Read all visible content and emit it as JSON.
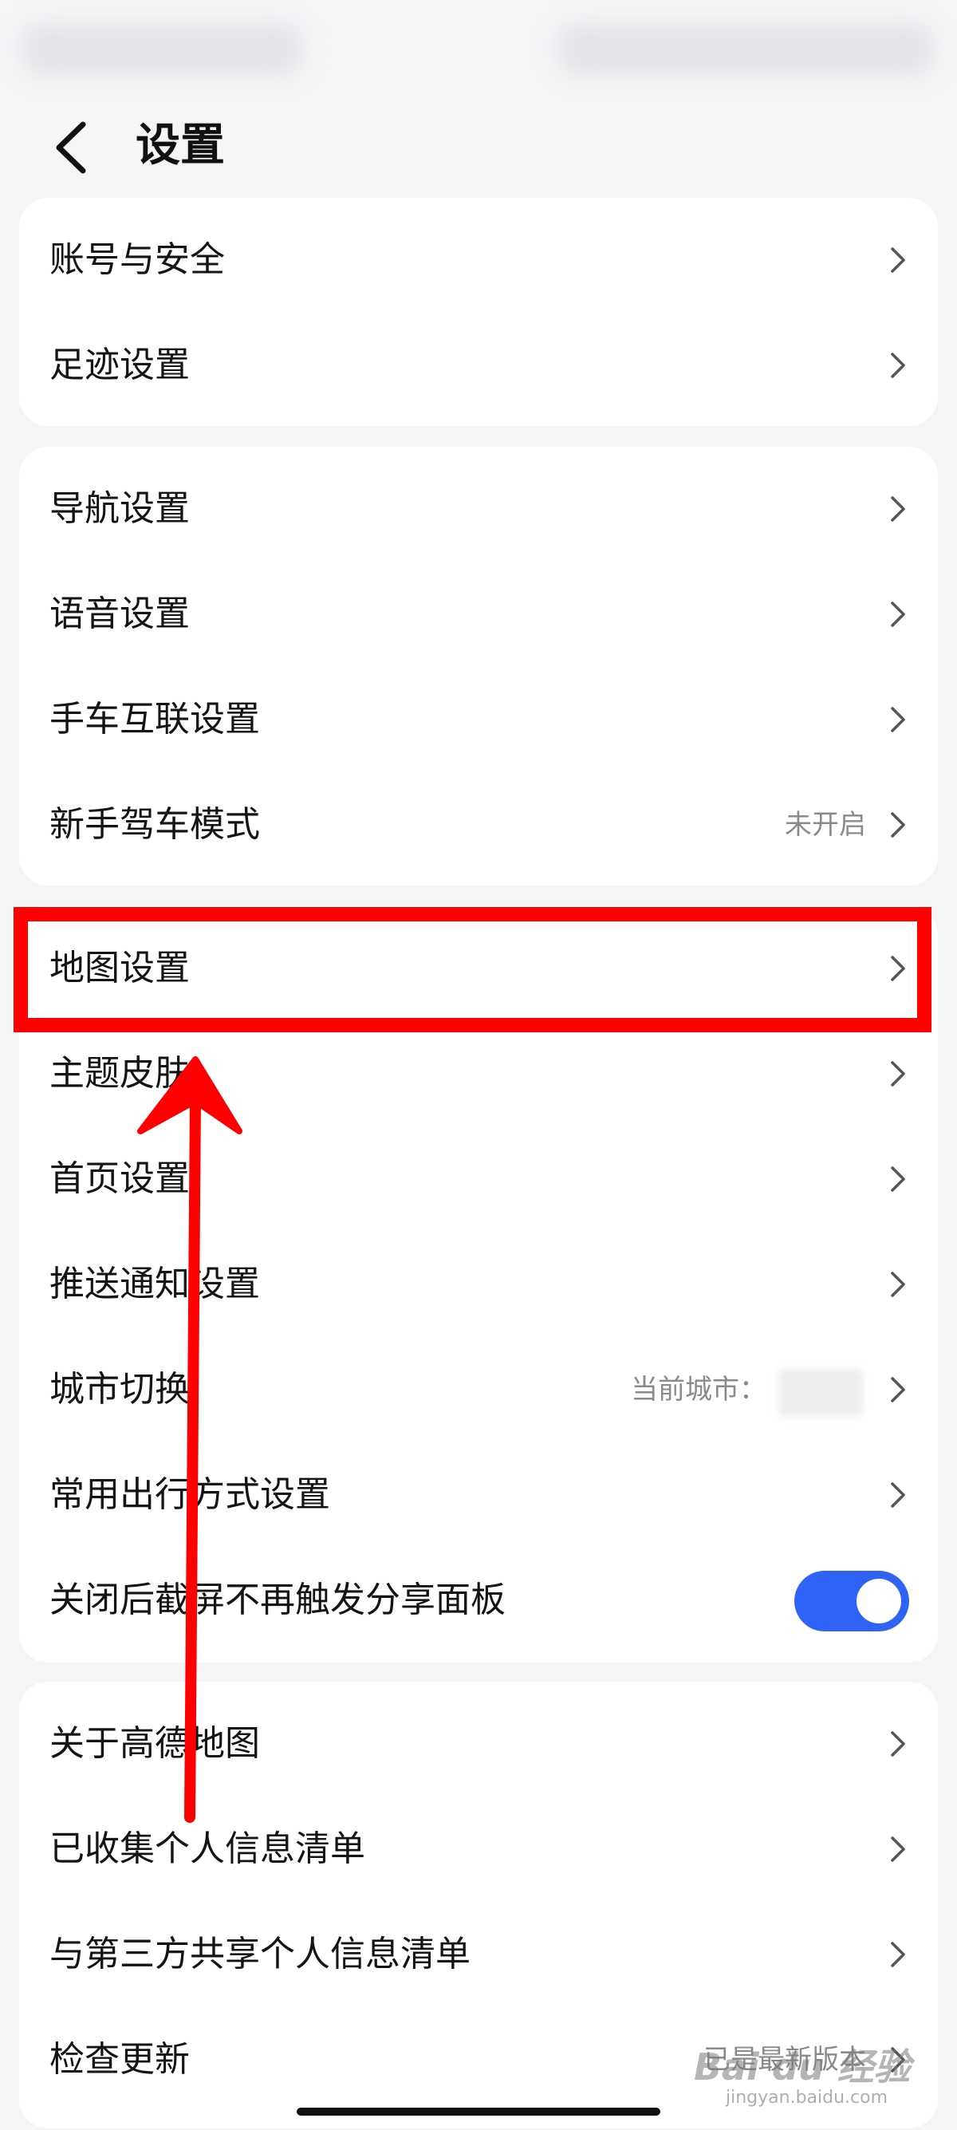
{
  "header": {
    "title": "设置"
  },
  "groups": [
    {
      "items": [
        {
          "label": "账号与安全"
        },
        {
          "label": "足迹设置"
        }
      ]
    },
    {
      "items": [
        {
          "label": "导航设置"
        },
        {
          "label": "语音设置"
        },
        {
          "label": "手车互联设置"
        },
        {
          "label": "新手驾车模式",
          "value": "未开启"
        }
      ]
    },
    {
      "items": [
        {
          "label": "地图设置"
        },
        {
          "label": "主题皮肤"
        },
        {
          "label": "首页设置"
        },
        {
          "label": "推送通知设置"
        },
        {
          "label": "城市切换",
          "value": "当前城市："
        },
        {
          "label": "常用出行方式设置"
        },
        {
          "label": "关闭后截屏不再触发分享面板",
          "toggle_on": true
        }
      ]
    },
    {
      "items": [
        {
          "label": "关于高德地图"
        },
        {
          "label": "已收集个人信息清单"
        },
        {
          "label": "与第三方共享个人信息清单"
        },
        {
          "label": "检查更新",
          "value": "已是最新版本"
        }
      ]
    }
  ],
  "watermark": {
    "brand": "Bai du 经验",
    "url": "jingyan.baidu.com"
  },
  "colors": {
    "accent_toggle": "#2f63f5",
    "annotation_red": "#ff0000",
    "background": "#f4f5f7"
  }
}
